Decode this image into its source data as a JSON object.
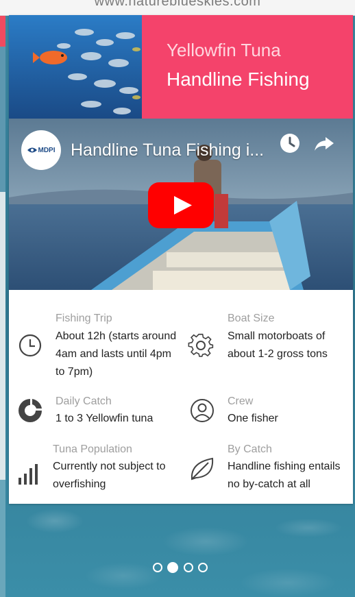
{
  "browser": {
    "url": "www.natureblueskies.com"
  },
  "hero": {
    "line1": "Yellowfin Tuna",
    "line2": "Handline Fishing"
  },
  "video": {
    "channel_logo_text": "MDPI",
    "title": "Handline Tuna Fishing i...",
    "watch_later_icon": "clock-icon",
    "share_icon": "share-arrow-icon",
    "play_icon": "youtube-play-icon"
  },
  "facts": [
    {
      "label": "Fishing Trip",
      "value": "About 12h (starts around 4am and lasts until 4pm to 7pm)",
      "icon": "clock-icon"
    },
    {
      "label": "Boat Size",
      "value": "Small motorboats of about 1-2 gross tons",
      "icon": "gear-icon"
    },
    {
      "label": "Daily Catch",
      "value": "1 to 3 Yellowfin tuna",
      "icon": "pie-chart-icon"
    },
    {
      "label": "Crew",
      "value": "One fisher",
      "icon": "person-icon"
    },
    {
      "label": "Tuna Population",
      "value": "Currently not subject to overfishing",
      "icon": "bar-chart-icon"
    },
    {
      "label": "By Catch",
      "value": "Handline fishing entails no by-catch at all",
      "icon": "leaf-icon"
    }
  ],
  "carousel": {
    "total": 4,
    "active_index": 1
  },
  "colors": {
    "accent": "#f4436b",
    "youtube_red": "#ff0000"
  }
}
